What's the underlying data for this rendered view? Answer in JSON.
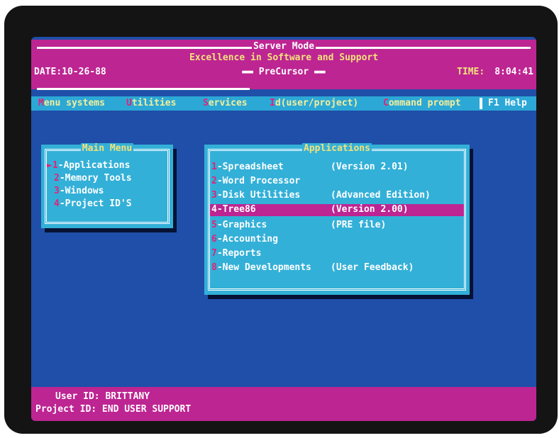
{
  "header": {
    "mode_title": "Server Mode",
    "tagline": "Excellence in Software and Support",
    "program": "PreCursor",
    "date_label": "DATE:",
    "date": "10-26-88",
    "time_label": "TIME:",
    "time": "8:04:41"
  },
  "menubar": {
    "items": [
      {
        "hotkey": "M",
        "rest": "enu systems"
      },
      {
        "hotkey": "U",
        "rest": "tilities"
      },
      {
        "hotkey": "S",
        "rest": "ervices"
      },
      {
        "hotkey": "I",
        "rest": "d(user/project)"
      },
      {
        "hotkey": "C",
        "rest": "ommand prompt"
      }
    ],
    "help": "F1 Help"
  },
  "main_menu": {
    "title": "Main Menu",
    "items": [
      {
        "num": "1",
        "label": "-Applications"
      },
      {
        "num": "2",
        "label": "-Memory Tools"
      },
      {
        "num": "3",
        "label": "-Windows"
      },
      {
        "num": "4",
        "label": "-Project ID'S"
      }
    ]
  },
  "applications": {
    "title": "Applications",
    "selected_index": 3,
    "items": [
      {
        "num": "1",
        "label": "-Spreadsheet",
        "version": "(Version 2.01)"
      },
      {
        "num": "2",
        "label": "-Word Processor",
        "version": ""
      },
      {
        "num": "3",
        "label": "-Disk Utilities",
        "version": "(Advanced Edition)"
      },
      {
        "num": "4",
        "label": "-Tree86",
        "version": "(Version 2.00)"
      },
      {
        "num": "5",
        "label": "-Graphics",
        "version": "(PRE file)"
      },
      {
        "num": "6",
        "label": "-Accounting",
        "version": ""
      },
      {
        "num": "7",
        "label": "-Reports",
        "version": ""
      },
      {
        "num": "8",
        "label": "-New Developments",
        "version": "(User Feedback)"
      }
    ]
  },
  "footer": {
    "user_label": "User ID:",
    "user": "BRITTANY",
    "project_label": "Project ID:",
    "project": "END USER SUPPORT"
  },
  "colors": {
    "screen_blue": "#1f4fa8",
    "magenta": "#bd2592",
    "cyan": "#33b0d8",
    "hotkey_red": "#e0237a",
    "yellow": "#f2e27a"
  }
}
